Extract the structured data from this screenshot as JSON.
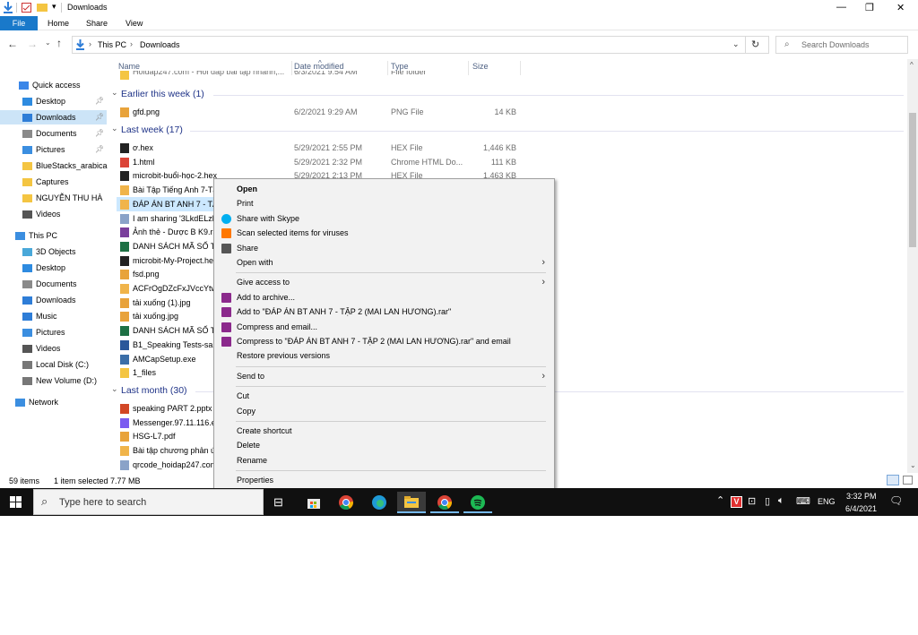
{
  "window": {
    "title": "Downloads",
    "minimize": "—",
    "restore": "❐",
    "close": "✕"
  },
  "ribbon": {
    "file": "File",
    "tabs": [
      "Home",
      "Share",
      "View"
    ]
  },
  "address": {
    "crumbs": [
      "This PC",
      "Downloads"
    ],
    "search_placeholder": "Search Downloads"
  },
  "nav": {
    "items": [
      {
        "label": "Quick access",
        "icon": "star-icon",
        "color": "#3a86e8"
      },
      {
        "label": "Desktop",
        "icon": "desktop-folder-icon",
        "color": "#2e8be0",
        "pinned": true
      },
      {
        "label": "Downloads",
        "icon": "download-arrow-icon",
        "color": "#2e7dd7",
        "pinned": true,
        "selected": true
      },
      {
        "label": "Documents",
        "icon": "documents-icon",
        "color": "#8a8a8a",
        "pinned": true
      },
      {
        "label": "Pictures",
        "icon": "pictures-icon",
        "color": "#3b8ee0",
        "pinned": true
      },
      {
        "label": "BlueStacks_arabica",
        "icon": "folder-icon",
        "color": "#f4c542"
      },
      {
        "label": "Captures",
        "icon": "folder-icon",
        "color": "#f4c542"
      },
      {
        "label": "NGUYỄN THU HÀ",
        "icon": "folder-icon",
        "color": "#f4c542"
      },
      {
        "label": "Videos",
        "icon": "videos-icon",
        "color": "#555"
      },
      {
        "label": "This PC",
        "icon": "computer-icon",
        "color": "#3b8ee0"
      },
      {
        "label": "3D Objects",
        "icon": "cube-icon",
        "color": "#49a8d9"
      },
      {
        "label": "Desktop",
        "icon": "desktop-folder-icon",
        "color": "#2e8be0"
      },
      {
        "label": "Documents",
        "icon": "documents-icon",
        "color": "#8a8a8a"
      },
      {
        "label": "Downloads",
        "icon": "download-arrow-icon",
        "color": "#2e7dd7"
      },
      {
        "label": "Music",
        "icon": "music-icon",
        "color": "#2e7dd7"
      },
      {
        "label": "Pictures",
        "icon": "pictures-icon",
        "color": "#3b8ee0"
      },
      {
        "label": "Videos",
        "icon": "videos-icon",
        "color": "#555"
      },
      {
        "label": "Local Disk (C:)",
        "icon": "drive-icon",
        "color": "#777"
      },
      {
        "label": "New Volume (D:)",
        "icon": "drive-icon",
        "color": "#777"
      },
      {
        "label": "Network",
        "icon": "network-icon",
        "color": "#3b8ee0"
      }
    ]
  },
  "columns": {
    "name": "Name",
    "date": "Date modified",
    "type": "Type",
    "size": "Size"
  },
  "groups": [
    {
      "label": "Earlier this week (1)"
    },
    {
      "label": "Last week (17)"
    },
    {
      "label": "Last month (30)"
    }
  ],
  "files": {
    "top": {
      "name": "Hoidap247.com - Hỏi đáp bài tập nhanh,...",
      "date": "6/3/2021 9:54 AM",
      "type": "File folder",
      "size": ""
    },
    "earlier": [
      {
        "name": "gfd.png",
        "date": "6/2/2021 9:29 AM",
        "type": "PNG File",
        "size": "14 KB",
        "icon": "image-file-icon"
      }
    ],
    "lastweek": [
      {
        "name": "ơ.hex",
        "date": "5/29/2021 2:55 PM",
        "type": "HEX File",
        "size": "1,446 KB",
        "icon": "hex-file-icon"
      },
      {
        "name": "1.html",
        "date": "5/29/2021 2:32 PM",
        "type": "Chrome HTML Do...",
        "size": "111 KB",
        "icon": "chrome-html-icon"
      },
      {
        "name": "microbit-buổi-học-2.hex",
        "date": "5/29/2021 2:13 PM",
        "type": "HEX File",
        "size": "1,463 KB",
        "icon": "hex-file-icon"
      },
      {
        "name": "Bài Tập Tiếng Anh 7-Tậ",
        "icon": "archive-file-icon"
      },
      {
        "name": "ĐÁP ÁN BT ANH 7 - TẬP",
        "icon": "archive-file-icon",
        "selected": true
      },
      {
        "name": "I am sharing '3LkdELzlv",
        "icon": "text-file-icon"
      },
      {
        "name": "Ảnh thẻ - Dược B K9.ra",
        "icon": "rar-file-icon"
      },
      {
        "name": "DANH SÁCH MÃ SỐ TI",
        "icon": "excel-file-icon"
      },
      {
        "name": "microbit-My-Project.he",
        "icon": "hex-file-icon"
      },
      {
        "name": "fsd.png",
        "icon": "image-file-icon"
      },
      {
        "name": "ACFrOgDZcFxJVccYtwz",
        "icon": "archive-file-icon"
      },
      {
        "name": "tải xuống (1).jpg",
        "icon": "image-file-icon"
      },
      {
        "name": "tải xuống.jpg",
        "icon": "image-file-icon"
      },
      {
        "name": "DANH SÁCH MÃ SỐ TI",
        "icon": "excel-file-icon"
      },
      {
        "name": "B1_Speaking Tests-sam",
        "icon": "word-file-icon"
      },
      {
        "name": "AMCapSetup.exe",
        "icon": "exe-file-icon"
      },
      {
        "name": "1_files",
        "icon": "folder-icon"
      }
    ],
    "lastmonth": [
      {
        "name": "speaking PART 2.pptx",
        "icon": "powerpoint-file-icon"
      },
      {
        "name": "Messenger.97.11.116.ex",
        "icon": "messenger-icon"
      },
      {
        "name": "HSG-L7.pdf",
        "icon": "pdf-file-icon"
      },
      {
        "name": "Bài tập chương phản ứ",
        "icon": "archive-file-icon"
      },
      {
        "name": "qrcode_hoidap247.com",
        "icon": "text-file-icon"
      }
    ]
  },
  "status": {
    "count": "59 items",
    "selection": "1 item selected",
    "size": "7.77 MB"
  },
  "context_menu": [
    {
      "label": "Open",
      "bold": true
    },
    {
      "label": "Print"
    },
    {
      "label": "Share with Skype",
      "icon": "skype-icon"
    },
    {
      "label": "Scan selected items for viruses",
      "icon": "avast-icon"
    },
    {
      "label": "Share",
      "icon": "share-icon"
    },
    {
      "label": "Open with",
      "submenu": true
    },
    {
      "sep": true
    },
    {
      "label": "Give access to",
      "submenu": true
    },
    {
      "label": "Add to archive...",
      "icon": "winrar-icon"
    },
    {
      "label": "Add to \"ĐÁP ÁN BT ANH 7 - TẬP 2 (MAI LAN HƯƠNG).rar\"",
      "icon": "winrar-icon"
    },
    {
      "label": "Compress and email...",
      "icon": "winrar-icon"
    },
    {
      "label": "Compress to \"ĐÁP ÁN BT ANH 7 - TẬP 2 (MAI LAN HƯƠNG).rar\" and email",
      "icon": "winrar-icon"
    },
    {
      "label": "Restore previous versions"
    },
    {
      "sep": true
    },
    {
      "label": "Send to",
      "submenu": true
    },
    {
      "sep": true
    },
    {
      "label": "Cut"
    },
    {
      "label": "Copy"
    },
    {
      "sep": true
    },
    {
      "label": "Create shortcut"
    },
    {
      "label": "Delete"
    },
    {
      "label": "Rename"
    },
    {
      "sep": true
    },
    {
      "label": "Properties"
    }
  ],
  "taskbar": {
    "search_placeholder": "Type here to search",
    "language": "ENG",
    "time": "3:32 PM",
    "date": "6/4/2021"
  }
}
